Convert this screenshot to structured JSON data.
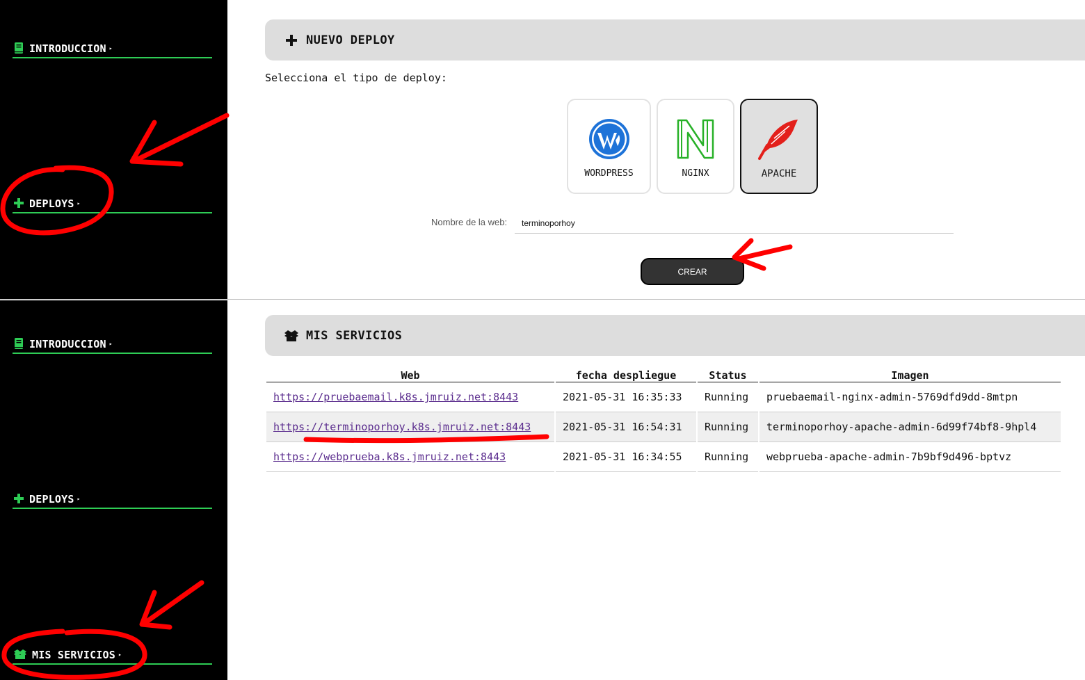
{
  "sidebar": {
    "items": [
      {
        "label": "INTRODUCCION",
        "icon": "book-icon"
      },
      {
        "label": "DEPLOYS",
        "icon": "plus-icon"
      },
      {
        "label": "MIS SERVICIOS",
        "icon": "boxes-icon"
      }
    ]
  },
  "deploy": {
    "title": "NUEVO DEPLOY",
    "prompt": "Selecciona el tipo de deploy:",
    "types": [
      {
        "label": "WORDPRESS",
        "icon": "wordpress-icon",
        "selected": false
      },
      {
        "label": "NGINX",
        "icon": "nginx-icon",
        "selected": false
      },
      {
        "label": "APACHE",
        "icon": "apache-feather-icon",
        "selected": true
      }
    ],
    "name_label": "Nombre de la web:",
    "name_value": "terminoporhoy",
    "create_label": "CREAR"
  },
  "services": {
    "title": "MIS SERVICIOS",
    "columns": [
      "Web",
      "fecha despliegue",
      "Status",
      "Imagen"
    ],
    "rows": [
      [
        "https://pruebaemail.k8s.jmruiz.net:8443",
        "2021-05-31 16:35:33",
        "Running",
        "pruebaemail-nginx-admin-5769dfd9dd-8mtpn"
      ],
      [
        "https://terminoporhoy.k8s.jmruiz.net:8443",
        "2021-05-31 16:54:31",
        "Running",
        "terminoporhoy-apache-admin-6d99f74bf8-9hpl4"
      ],
      [
        "https://webprueba.k8s.jmruiz.net:8443",
        "2021-05-31 16:34:55",
        "Running",
        "webprueba-apache-admin-7b9bf9d496-bptvz"
      ]
    ]
  },
  "colors": {
    "accent_green": "#2ecc55",
    "sidebar_bg": "#000000",
    "annotation_red": "#ff0000",
    "link_purple": "#5b2d8e"
  }
}
